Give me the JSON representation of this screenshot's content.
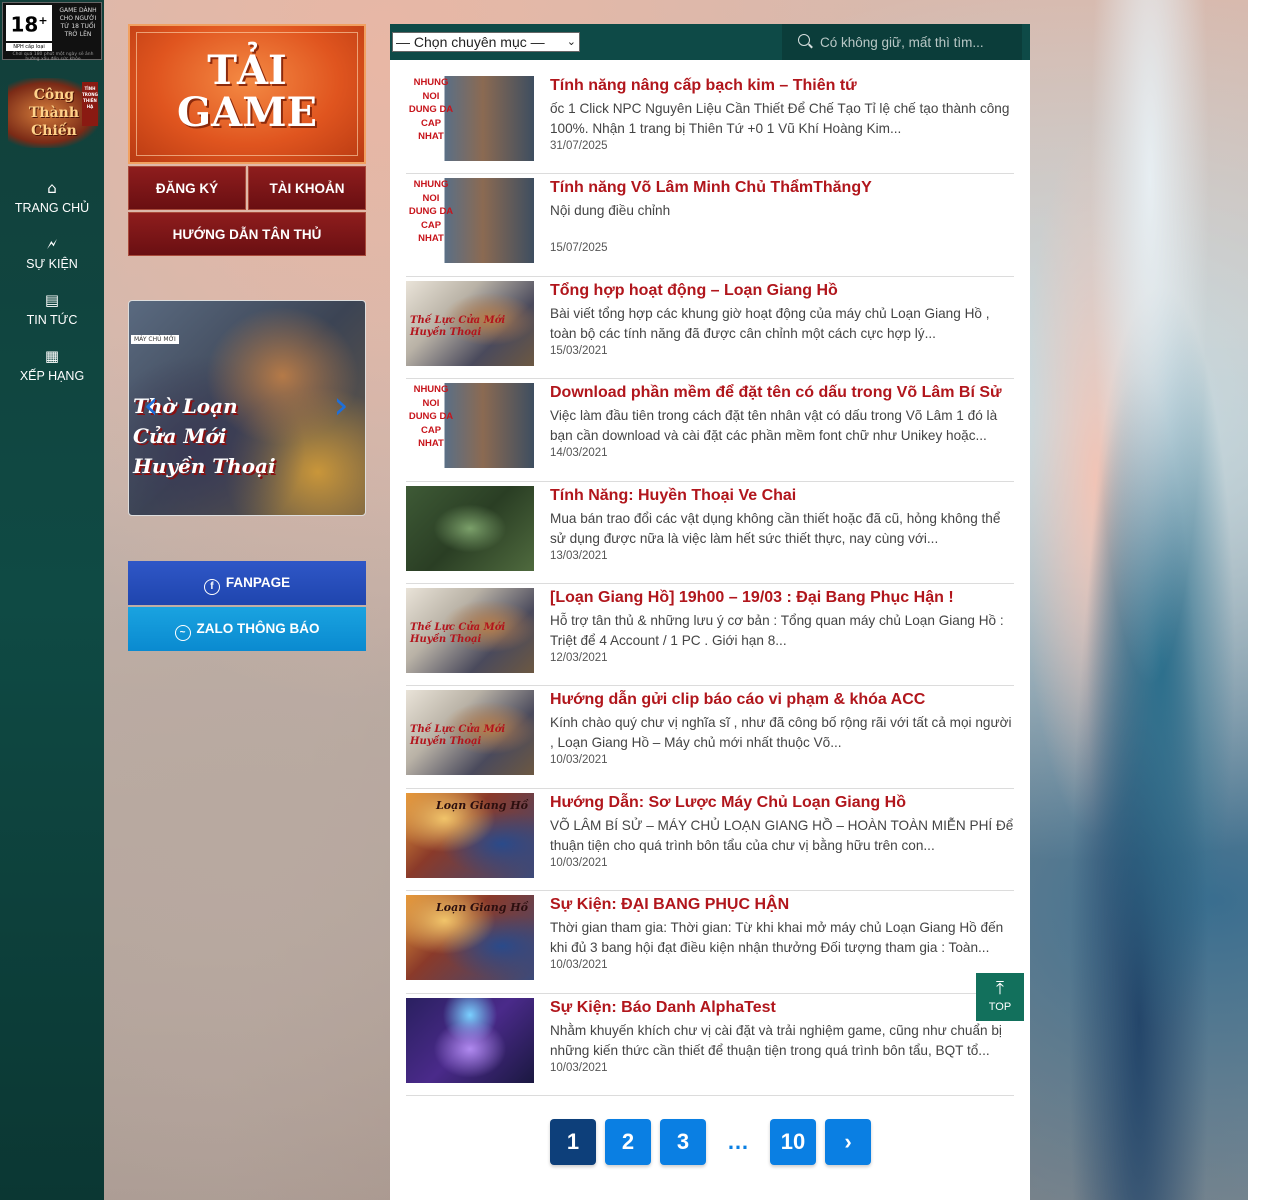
{
  "age_rating": {
    "badge": "18",
    "plus": "+",
    "side_text": "GAME DÀNH CHO NGƯỜI TỪ 18 TUỔI TRỞ LÊN",
    "publisher_text": "NPH cấp loại",
    "note": "Chơi quá 180 phút một ngày sẽ ảnh hưởng xấu đến sức khỏe"
  },
  "logo": {
    "text": "Công Thành Chiến",
    "tag": "TÌNH TRONG THIÊN HẠ"
  },
  "sidebar": {
    "items": [
      {
        "label": "TRANG CHỦ",
        "icon": "⌂"
      },
      {
        "label": "SỰ KIỆN",
        "icon": "🗲"
      },
      {
        "label": "TIN TỨC",
        "icon": "▤"
      },
      {
        "label": "XẾP HẠNG",
        "icon": "▦"
      }
    ]
  },
  "download": {
    "title_line1": "TẢI",
    "title_line2": "GAME"
  },
  "account": {
    "register_label": "ĐĂNG KÝ",
    "account_label": "TÀI KHOẢN",
    "guide_label": "HƯỚNG DẪN TÂN THỦ"
  },
  "slider": {
    "tag": "MÁY CHỦ MỚI",
    "caption_line1": "Thờ Loạn",
    "caption_line2": "Cửa Mới",
    "caption_line3": "Huyền Thoại"
  },
  "social": {
    "fanpage_label": "FANPAGE",
    "zalo_label": "ZALO THÔNG BÁO"
  },
  "topbar": {
    "category_select": "— Chọn chuyên mục —",
    "search_placeholder": "Có không giữ, mất thì tìm..."
  },
  "posts": [
    {
      "title": "Tính năng nâng cấp bạch kim – Thiên tứ",
      "excerpt": "ốc 1 Click NPC Nguyên Liệu Cần Thiết Để Chế Tạo  Tỉ lệ chế tạo thành công 100%. Nhận 1 trang bị Thiên Tứ +0 1 Vũ Khí Hoàng Kim...",
      "date": "31/07/2025",
      "thumb": "t-red",
      "stamp": "NHUNG NOI DUNG DA CAP NHAT"
    },
    {
      "title": "Tính năng Võ Lâm Minh Chủ ThẩmThăngY",
      "excerpt": "Nội dung điều chỉnh",
      "date": "15/07/2025",
      "thumb": "t-red",
      "stamp": "NHUNG NOI DUNG DA CAP NHAT"
    },
    {
      "title": "Tổng hợp hoạt động – Loạn Giang Hồ",
      "excerpt": "Bài viết tổng hợp các khung giờ hoạt động của máy chủ Loạn Giang Hồ , toàn bộ các tính năng đã được cân chỉnh một cách cực hợp lý...",
      "date": "15/03/2021",
      "thumb": "t-hero",
      "stamp": "Thế Lực Cửa Mới Huyền Thoại"
    },
    {
      "title": "Download phần mềm để đặt tên có dấu trong Võ Lâm Bí Sử",
      "excerpt": "Việc làm đầu tiên trong cách đặt tên nhân vật có dấu trong Võ Lâm 1 đó là bạn cần download và cài đặt các phần mềm font chữ như Unikey hoặc...",
      "date": "14/03/2021",
      "thumb": "t-red",
      "stamp": "NHUNG NOI DUNG DA CAP NHAT"
    },
    {
      "title": "Tính Năng: Huyền Thoại Ve Chai",
      "excerpt": "Mua bán trao đổi các vật dụng không cần thiết hoặc đã cũ, hỏng không thể sử dụng được nữa là việc làm hết sức thiết thực, nay cùng với...",
      "date": "13/03/2021",
      "thumb": "t-game",
      "stamp": ""
    },
    {
      "title": "[Loạn Giang Hồ] 19h00 – 19/03 : Đại Bang Phục Hận !",
      "excerpt": "Hỗ trợ tân thủ & những lưu ý cơ bản : Tổng quan máy chủ Loạn Giang Hồ : Triệt để 4 Account / 1 PC . Giới hạn 8...",
      "date": "12/03/2021",
      "thumb": "t-hero",
      "stamp": "Thế Lực Cửa Mới Huyền Thoại"
    },
    {
      "title": "Hướng dẫn gửi clip báo cáo vi phạm & khóa ACC",
      "excerpt": "Kính chào quý chư vị nghĩa sĩ , như đã công bố rộng rãi với tất cả mọi người , Loạn Giang Hồ – Máy chủ mới nhất thuộc Võ...",
      "date": "10/03/2021",
      "thumb": "t-hero",
      "stamp": "Thế Lực Cửa Mới Huyền Thoại"
    },
    {
      "title": "Hướng Dẫn: Sơ Lược Máy Chủ Loạn Giang Hồ",
      "excerpt": "VÕ LÂM BÍ SỬ – MÁY CHỦ LOẠN GIANG HỒ – HOÀN TOÀN MIỄN PHÍ Để thuận tiện cho quá trình bôn tẩu của chư vị bằng hữu trên con...",
      "date": "10/03/2021",
      "thumb": "t-war",
      "stamp": "Loạn Giang Hồ"
    },
    {
      "title": "Sự Kiện: ĐẠI BANG PHỤC HẬN",
      "excerpt": "Thời gian tham gia: Thời gian: Từ khi khai mở máy chủ Loạn Giang Hồ đến khi đủ 3 bang hội đạt điều kiện nhận thưởng Đối tượng tham gia : Toàn...",
      "date": "10/03/2021",
      "thumb": "t-war",
      "stamp": "Loạn Giang Hồ"
    },
    {
      "title": "Sự Kiện: Báo Danh AlphaTest",
      "excerpt": "Nhằm khuyến khích chư vị cài đặt và trải nghiệm game, cũng như chuẩn bị những kiến thức cần thiết để thuận tiện trong quá trình bôn tẩu, BQT tổ...",
      "date": "10/03/2021",
      "thumb": "t-magic",
      "stamp": ""
    }
  ],
  "pagination": {
    "pages": [
      "1",
      "2",
      "3",
      "10"
    ],
    "dots": "…",
    "next": "›",
    "current": "1"
  },
  "back_to_top": {
    "label": "TOP",
    "arrow": "⤒"
  }
}
